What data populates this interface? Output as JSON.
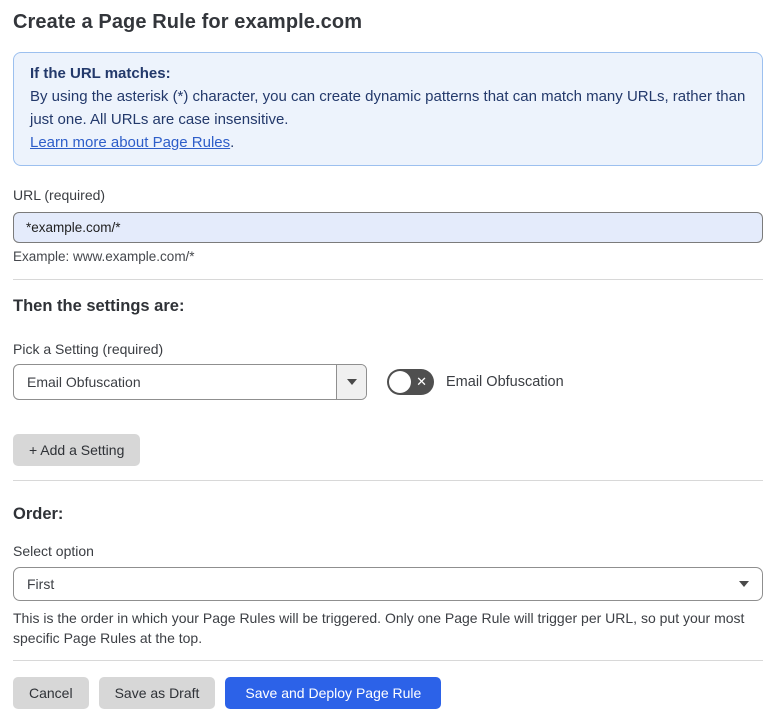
{
  "page": {
    "title": "Create a Page Rule for example.com"
  },
  "info_box": {
    "heading": "If the URL matches:",
    "body": "By using the asterisk (*) character, you can create dynamic patterns that can match many URLs, rather than just one. All URLs are case insensitive.",
    "link_label": "Learn more about Page Rules",
    "link_suffix": "."
  },
  "url_field": {
    "label": "URL (required)",
    "value": "*example.com/*",
    "hint": "Example: www.example.com/*"
  },
  "settings_section": {
    "heading": "Then the settings are:",
    "picker_label": "Pick a Setting (required)",
    "picker_value": "Email Obfuscation",
    "toggle_label": "Email Obfuscation",
    "toggle_state": "off",
    "toggle_icon": "✕",
    "add_button_label": "+ Add a Setting"
  },
  "order_section": {
    "heading": "Order:",
    "select_label": "Select option",
    "select_value": "First",
    "help_text": "This is the order in which your Page Rules will be triggered. Only one Page Rule will trigger per URL, so put your most specific Page Rules at the top."
  },
  "footer": {
    "cancel_label": "Cancel",
    "save_draft_label": "Save as Draft",
    "save_deploy_label": "Save and Deploy Page Rule"
  },
  "colors": {
    "info_box_bg": "#edf3fc",
    "info_box_border": "#9cc0ef",
    "info_box_text": "#23396b",
    "link": "#2e5ec9",
    "url_input_bg": "#e4ebfb",
    "toggle_off_bg": "#4f4f4f",
    "gray_button_bg": "#d7d7d7",
    "primary_button_bg": "#2c62e8",
    "primary_button_text": "#ffffff"
  }
}
